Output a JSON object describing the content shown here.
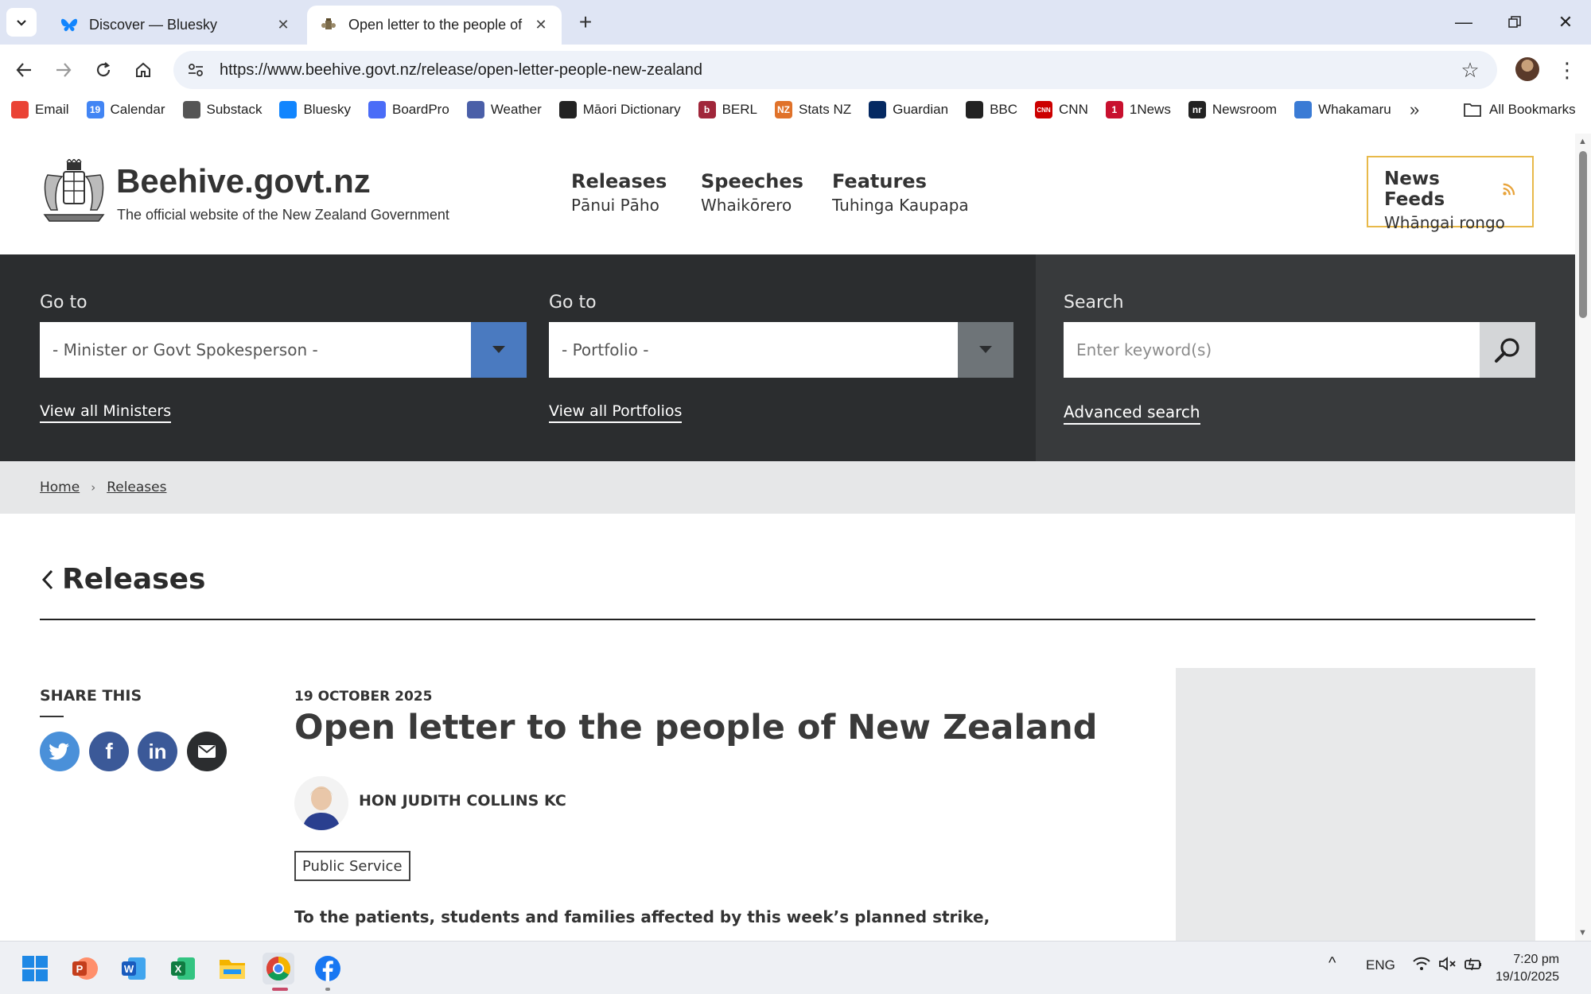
{
  "browser": {
    "tabs": [
      {
        "title": "Discover — Bluesky",
        "active": false
      },
      {
        "title": "Open letter to the people of New Zealand",
        "active": true
      }
    ],
    "url": "https://www.beehive.govt.nz/release/open-letter-people-new-zealand",
    "bookmarks": [
      {
        "label": "Email",
        "icon": "gmail-icon",
        "color": "#ea4335"
      },
      {
        "label": "Calendar",
        "icon": "calendar-icon",
        "color": "#4285f4",
        "glyph": "19"
      },
      {
        "label": "Substack",
        "icon": "substack-icon",
        "color": "#555555"
      },
      {
        "label": "Bluesky",
        "icon": "bluesky-icon",
        "color": "#1185fe"
      },
      {
        "label": "BoardPro",
        "icon": "boardpro-icon",
        "color": "#4a6cf7"
      },
      {
        "label": "Weather",
        "icon": "weather-icon",
        "color": "#4a5fa8"
      },
      {
        "label": "Māori Dictionary",
        "icon": "dictionary-icon",
        "color": "#222222"
      },
      {
        "label": "BERL",
        "icon": "berl-icon",
        "color": "#a0263a",
        "glyph": "b"
      },
      {
        "label": "Stats NZ",
        "icon": "statsnz-icon",
        "color": "#e0722a",
        "glyph": "NZ"
      },
      {
        "label": "Guardian",
        "icon": "guardian-icon",
        "color": "#052962"
      },
      {
        "label": "BBC",
        "icon": "bbc-icon",
        "color": "#222222"
      },
      {
        "label": "CNN",
        "icon": "cnn-icon",
        "color": "#cc0000",
        "glyph": "CNN"
      },
      {
        "label": "1News",
        "icon": "1news-icon",
        "color": "#c8102e",
        "glyph": "1"
      },
      {
        "label": "Newsroom",
        "icon": "newsroom-icon",
        "color": "#222222",
        "glyph": "nr"
      },
      {
        "label": "Whakamaru",
        "icon": "whakamaru-icon",
        "color": "#3a7bd5"
      }
    ],
    "all_bookmarks": "All Bookmarks"
  },
  "site": {
    "title": "Beehive.govt.nz",
    "subtitle": "The official website of the New Zealand Government",
    "nav": [
      {
        "en": "Releases",
        "mi": "Pānui Pāho"
      },
      {
        "en": "Speeches",
        "mi": "Whaikōrero"
      },
      {
        "en": "Features",
        "mi": "Tuhinga Kaupapa"
      }
    ],
    "news_feeds": {
      "en": "News Feeds",
      "mi": "Whāngai rongo"
    }
  },
  "filters": {
    "minister": {
      "label": "Go to",
      "value": "- Minister or Govt Spokesperson -",
      "link": "View all Ministers"
    },
    "portfolio": {
      "label": "Go to",
      "value": "- Portfolio -",
      "link": "View all Portfolios"
    },
    "search": {
      "label": "Search",
      "placeholder": "Enter keyword(s)",
      "link": "Advanced search"
    },
    "colors": {
      "minister_dd": "#4a7ac0",
      "portfolio_dd": "#6e7478"
    }
  },
  "breadcrumb": [
    "Home",
    "Releases"
  ],
  "section": {
    "title": "Releases"
  },
  "share": {
    "label": "SHARE THIS",
    "buttons": [
      {
        "name": "twitter",
        "color": "#4a90d9"
      },
      {
        "name": "facebook",
        "color": "#3b5998"
      },
      {
        "name": "linkedin",
        "color": "#3b5998"
      },
      {
        "name": "email",
        "color": "#2b2d2f"
      }
    ]
  },
  "article": {
    "date": "19 OCTOBER 2025",
    "title": "Open letter to the people of New Zealand",
    "minister": "HON JUDITH COLLINS KC",
    "portfolio_tag": "Public Service",
    "lead": "To the patients, students and families affected by this week’s planned strike,"
  },
  "taskbar": {
    "language": "ENG",
    "time": "7:20 pm",
    "date": "19/10/2025"
  }
}
